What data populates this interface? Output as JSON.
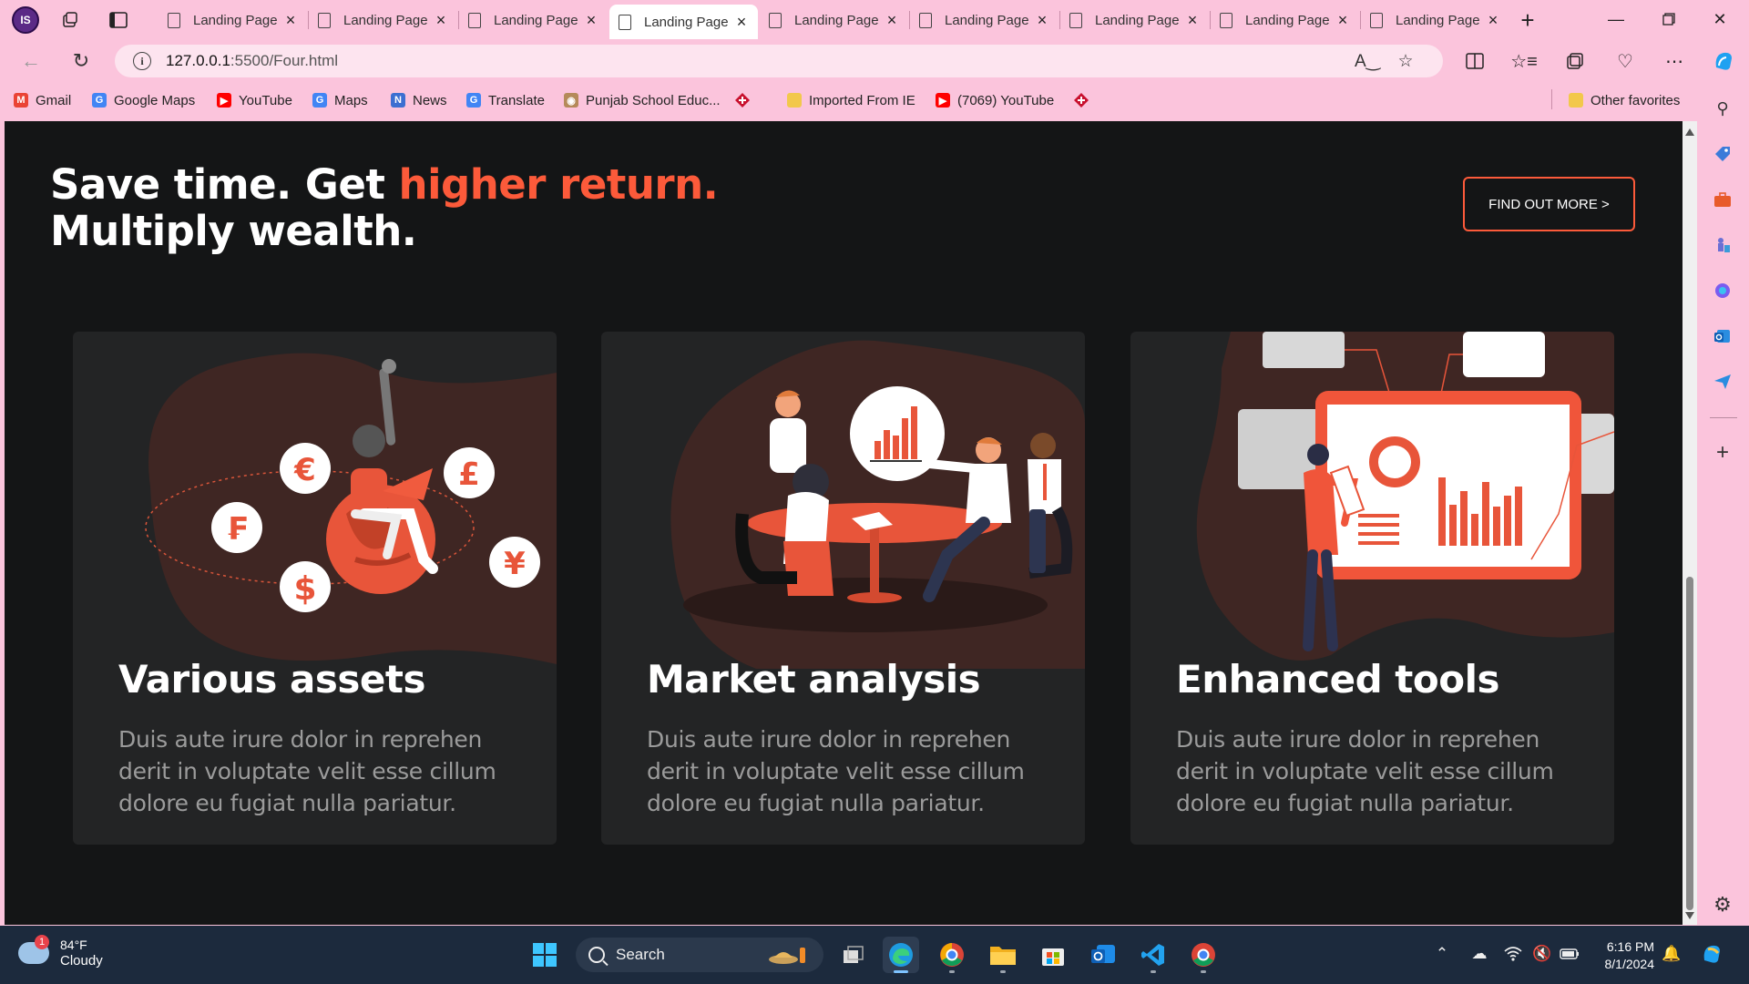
{
  "browser": {
    "profile_initials": "IS",
    "tabs": [
      {
        "title": "Landing Page",
        "active": false
      },
      {
        "title": "Landing Page",
        "active": false
      },
      {
        "title": "Landing Page",
        "active": false
      },
      {
        "title": "Landing Page",
        "active": true
      },
      {
        "title": "Landing Page",
        "active": false
      },
      {
        "title": "Landing Page",
        "active": false
      },
      {
        "title": "Landing Page",
        "active": false
      },
      {
        "title": "Landing Page",
        "active": false
      },
      {
        "title": "Landing Page",
        "active": false
      }
    ],
    "new_tab": "+",
    "address": {
      "host": "127.0.0.1",
      "rest": ":5500/Four.html"
    },
    "bookmarks": [
      {
        "label": "Gmail",
        "icon": "gmail-icon",
        "color": "#ea4335"
      },
      {
        "label": "Google Maps",
        "icon": "google-icon",
        "color": "#4285f4"
      },
      {
        "label": "YouTube",
        "icon": "youtube-icon",
        "color": "#ff0000"
      },
      {
        "label": "Maps",
        "icon": "google-icon",
        "color": "#4285f4"
      },
      {
        "label": "News",
        "icon": "news-icon",
        "color": "#3c6fd1"
      },
      {
        "label": "Translate",
        "icon": "translate-icon",
        "color": "#4285f4"
      },
      {
        "label": "Punjab School Educ...",
        "icon": "seal-icon",
        "color": "#b58a5a"
      },
      {
        "label": "Imported From IE",
        "icon": "folder-icon",
        "color": "#f2c84b"
      },
      {
        "label": "(7069) YouTube",
        "icon": "youtube-icon",
        "color": "#ff0000"
      }
    ],
    "other_favorites": "Other favorites"
  },
  "page": {
    "hero_line1_plain": "Save time. Get ",
    "hero_line1_accent": "higher return.",
    "hero_line2": "Multiply wealth.",
    "cta": "FIND OUT MORE >",
    "colors": {
      "accent": "#fc5a3a",
      "background": "#141516",
      "card": "#232425",
      "blob": "#3f2623"
    },
    "cards": [
      {
        "title": "Various assets",
        "text": "Duis aute irure dolor in reprehen derit in voluptate velit esse cillum dolore eu fugiat nulla pariatur.",
        "illustration": "currency-globe-illustration",
        "symbols": [
          "€",
          "£",
          "₣",
          "$",
          "¥"
        ]
      },
      {
        "title": "Market analysis",
        "text": "Duis aute irure dolor in reprehen derit in voluptate velit esse cillum dolore eu fugiat nulla pariatur.",
        "illustration": "meeting-illustration"
      },
      {
        "title": "Enhanced tools",
        "text": "Duis aute irure dolor in reprehen derit in voluptate velit esse cillum dolore eu fugiat nulla pariatur.",
        "illustration": "dashboard-illustration"
      }
    ]
  },
  "taskbar": {
    "weather": {
      "temp": "84°F",
      "desc": "Cloudy",
      "badge": "1"
    },
    "search": "Search",
    "time": "6:16 PM",
    "date": "8/1/2024"
  }
}
